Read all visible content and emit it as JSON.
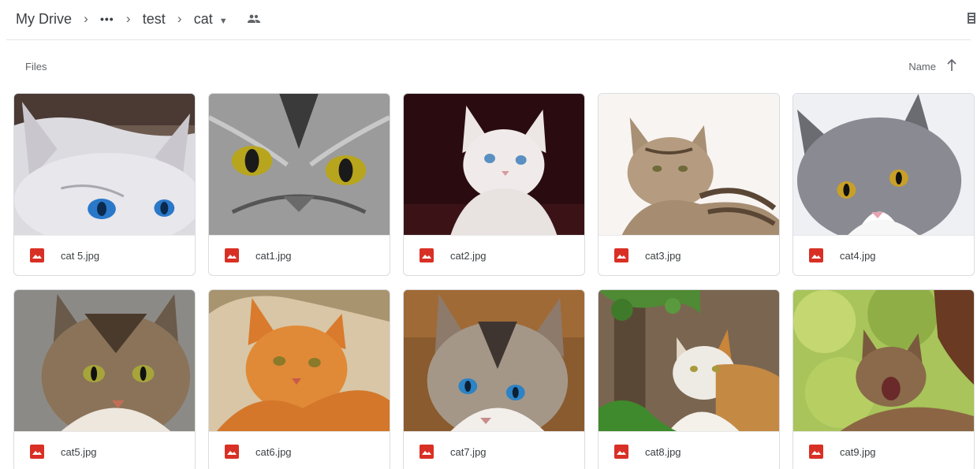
{
  "breadcrumb": {
    "root": "My Drive",
    "more": "•••",
    "folder1": "test",
    "current": "cat"
  },
  "section": {
    "title": "Files"
  },
  "sort": {
    "label": "Name"
  },
  "files": [
    {
      "name": "cat 5.jpg"
    },
    {
      "name": "cat1.jpg"
    },
    {
      "name": "cat2.jpg"
    },
    {
      "name": "cat3.jpg"
    },
    {
      "name": "cat4.jpg"
    },
    {
      "name": "cat5.jpg"
    },
    {
      "name": "cat6.jpg"
    },
    {
      "name": "cat7.jpg"
    },
    {
      "name": "cat8.jpg"
    },
    {
      "name": "cat9.jpg"
    }
  ],
  "colors": {
    "accent_red": "#d93025",
    "border": "#dadce0",
    "text": "#3c4043"
  },
  "icons": {
    "image_file": "image-file-icon",
    "shared": "shared-folder-icon",
    "sort": "arrow-up-icon"
  }
}
